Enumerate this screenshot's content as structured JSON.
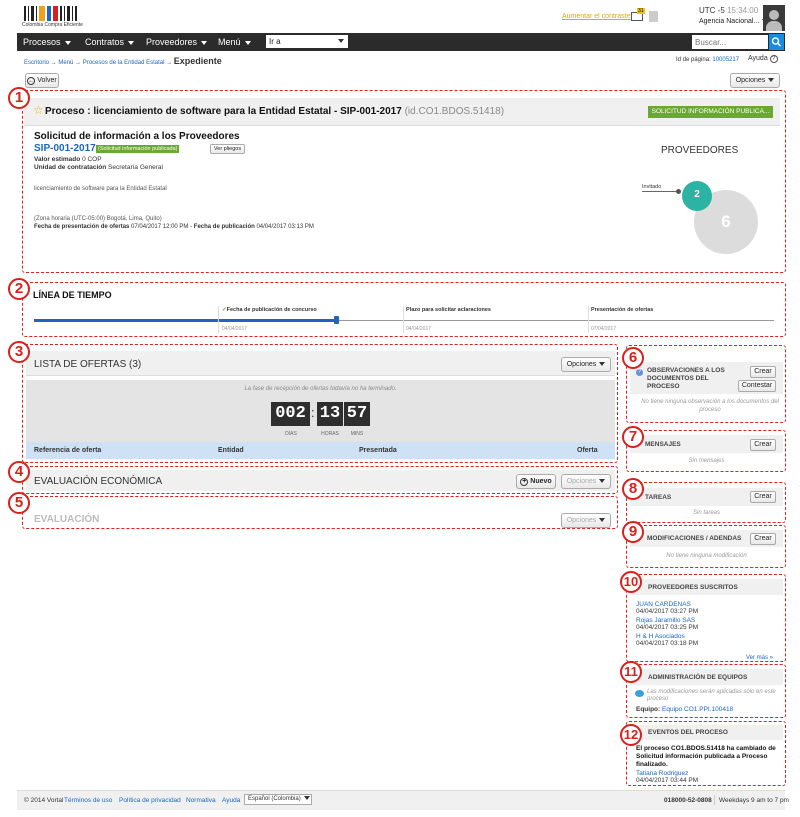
{
  "header": {
    "logo_text": "Colombia Compra Eficiente",
    "increase_contrast": "Aumentar el contraste",
    "mail_count": "31",
    "timezone": "UTC -5",
    "time": "15:34:00",
    "agency": "Agencia Nacional...",
    "search_placeholder": "Buscar..."
  },
  "nav": {
    "items": [
      "Procesos",
      "Contratos",
      "Proveedores",
      "Menú"
    ],
    "goto_label": "Ir a"
  },
  "breadcrumb": {
    "items": [
      "Escritorio",
      "Menú",
      "Procesos de la Entidad Estatal"
    ],
    "current": "Expediente",
    "page_id_label": "Id de página:",
    "page_id": "10005217",
    "help": "Ayuda"
  },
  "toolbar": {
    "back": "Volver",
    "options": "Opciones"
  },
  "annotations": [
    "1",
    "2",
    "3",
    "4",
    "5",
    "6",
    "7",
    "8",
    "9",
    "10",
    "11",
    "12"
  ],
  "process": {
    "title": "Proceso : licenciamiento de software para la Entidad Estatal - SIP-001-2017",
    "id": "(id.CO1.BDOS.51418)",
    "status_badge": "SOLICITUD INFORMACIÓN PUBLICA...",
    "subtitle": "Solicitud de información a los Proveedores",
    "code": "SIP-001-2017",
    "code_badge": "(Solicitud información publicada)",
    "view_docs": "Ver pliegos",
    "value_label": "Valor estimado",
    "value": "0 COP",
    "unit_label": "Unidad de contratación",
    "unit": "Secretaría General",
    "description": "licenciamiento de software para la Entidad Estatal",
    "tz": "(Zona horaria (UTC-05:00) Bogotá, Lima, Quito)",
    "offers_date_label": "Fecha de presentación de ofertas",
    "offers_date": "07/04/2017 12:00 PM",
    "pub_date_label": "Fecha de publicación",
    "pub_date": "04/04/2017 03:13 PM",
    "suppliers_title": "PROVEEDORES",
    "invited_label": "Invitado",
    "invited_count": "2",
    "total_count": "6"
  },
  "timeline": {
    "title": "LÍNEA DE TIEMPO",
    "progress": 0.41,
    "steps": [
      {
        "label": "Fecha de publicación de concurso",
        "date": "04/04/2017"
      },
      {
        "label": "Plazo para solicitar aclaraciones",
        "date": "04/04/2017"
      },
      {
        "label": "Presentación de ofertas",
        "date": "07/04/2017"
      }
    ],
    "first_date": "04/04/2017"
  },
  "offers": {
    "title": "LISTA DE OFERTAS (3)",
    "options": "Opciones",
    "notice": "La fase de recepción de ofertas todavía no ha terminado.",
    "countdown": {
      "d": "002",
      "h": "13",
      "m": "57",
      "d_label": "DÍAS",
      "h_label": "HORAS",
      "m_label": "MINS"
    },
    "columns": [
      "Referencia de oferta",
      "Entidad",
      "Presentada",
      "Oferta"
    ]
  },
  "economic": {
    "title": "EVALUACIÓN ECONÓMICA",
    "new": "Nuevo",
    "options": "Opciones"
  },
  "evaluation": {
    "title": "EVALUACIÓN",
    "options": "Opciones"
  },
  "sidebar": {
    "observations": {
      "title": "OBSERVACIONES A LOS DOCUMENTOS DEL PROCESO",
      "create": "Crear",
      "answer": "Contestar",
      "empty": "No tiene ninguna observación a los documentos del proceso"
    },
    "messages": {
      "title": "MENSAJES",
      "create": "Crear",
      "empty": "Sin mensajes"
    },
    "tasks": {
      "title": "TAREAS",
      "create": "Crear",
      "empty": "Sin tareas"
    },
    "modifications": {
      "title": "MODIFICACIONES / ADENDAS",
      "create": "Crear",
      "empty": "No tiene ninguna modificación"
    },
    "subscribed": {
      "title": "PROVEEDORES SUSCRITOS",
      "items": [
        {
          "name": "JUAN CARDENAS",
          "date": "04/04/2017 03:27 PM"
        },
        {
          "name": "Rojas Jaramillo SAS",
          "date": "04/04/2017 03:25 PM"
        },
        {
          "name": "H & H Asociados",
          "date": "04/04/2017 03:18 PM"
        }
      ],
      "more": "Ver más »"
    },
    "teams": {
      "title": "ADMINISTRACIÓN DE EQUIPOS",
      "note": "Las modificaciones serán aplicadas sólo en este proceso",
      "team_label": "Equipo:",
      "team": "Equipo CO1.PPI.100418"
    },
    "events": {
      "title": "EVENTOS DEL PROCESO",
      "text": "El proceso CO1.BDOS.51418 ha cambiado de Solicitud información publicada a Proceso finalizado.",
      "user": "Tatiana Rodriguez",
      "date": "04/04/2017 03:44 PM"
    }
  },
  "footer": {
    "copyright": "© 2014 Vortal",
    "links": [
      "Términos de uso",
      "Política de privacidad",
      "Normativa",
      "Ayuda"
    ],
    "language": "Español (Colombia)",
    "phone": "018000-52-0808",
    "hours": "Weekdays 9 am to 7 pm"
  }
}
